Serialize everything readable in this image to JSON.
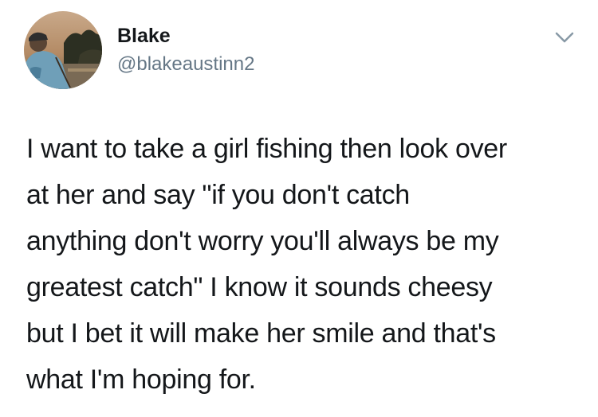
{
  "author": {
    "display_name": "Blake",
    "handle": "@blakeaustinn2"
  },
  "icons": {
    "avatar": "avatar-photo",
    "menu": "chevron-down-icon"
  },
  "tweet": {
    "lines": [
      "I want to take a girl fishing then look over",
      "at her and say \"if you don't catch",
      "anything don't worry you'll always be my",
      "greatest catch\" I know it sounds cheesy",
      "but I bet it will make her smile and that's",
      "what I'm hoping for."
    ]
  },
  "colors": {
    "text": "#14171a",
    "secondary": "#657786",
    "caret": "#8899a6"
  }
}
